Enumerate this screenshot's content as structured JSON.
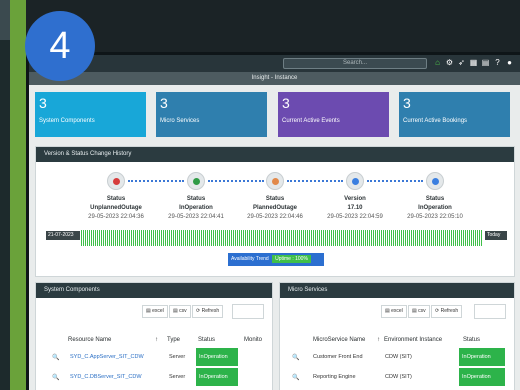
{
  "step_badge": "4",
  "topbar": {
    "search_placeholder": "Search...",
    "icons": [
      "home-icon",
      "gear-icon",
      "rocket-icon",
      "calendar-icon",
      "printer-icon",
      "help-icon",
      "user-icon"
    ]
  },
  "title": "Insight - Instance",
  "cards": [
    {
      "value": "3",
      "label": "System Components",
      "color": "#18a7d8"
    },
    {
      "value": "3",
      "label": "Micro Services",
      "color": "#2f7fae"
    },
    {
      "value": "3",
      "label": "Current Active Events",
      "color": "#6c4bb0"
    },
    {
      "value": "3",
      "label": "Current Active Bookings",
      "color": "#2f7fae"
    }
  ],
  "history": {
    "title": "Version & Status Change History",
    "events": [
      {
        "title": "Status",
        "value": "UnplannedOutage",
        "date": "29-05-2023 22:04:36",
        "color": "#d63c3c"
      },
      {
        "title": "Status",
        "value": "InOperation",
        "date": "29-05-2023 22:04:41",
        "color": "#2f9b46"
      },
      {
        "title": "Status",
        "value": "PlannedOutage",
        "date": "29-05-2023 22:04:46",
        "color": "#e2894a"
      },
      {
        "title": "Version",
        "value": "17.10",
        "date": "29-05-2023 22:04:59",
        "color": "#3b7fe0"
      },
      {
        "title": "Status",
        "value": "InOperation",
        "date": "29-05-2023 22:05:10",
        "color": "#3b7fe0"
      }
    ],
    "availability_start": "21-07-2023",
    "availability_end": "Today",
    "trend_label": "Availability Trend",
    "trend_value": "Uptime : 100%"
  },
  "system_components": {
    "title": "System Components",
    "buttons": [
      "excel",
      "csv",
      "Refresh"
    ],
    "columns": [
      "Resource Name",
      "Type",
      "Status",
      "Monito"
    ],
    "rows": [
      {
        "name": "SYD_C.AppServer_SIT_CDW",
        "type": "Server",
        "status": "InOperation"
      },
      {
        "name": "SYD_C.DBServer_SIT_CDW",
        "type": "Server",
        "status": "InOperation"
      }
    ]
  },
  "micro_services": {
    "title": "Micro Services",
    "buttons": [
      "excel",
      "csv",
      "Refresh"
    ],
    "columns": [
      "MicroService Name",
      "Environment Instance",
      "Status"
    ],
    "rows": [
      {
        "name": "Customer Front End",
        "env": "CDW (SIT)",
        "status": "InOperation"
      },
      {
        "name": "Reporting Engine",
        "env": "CDW (SIT)",
        "status": "InOperation"
      }
    ]
  }
}
